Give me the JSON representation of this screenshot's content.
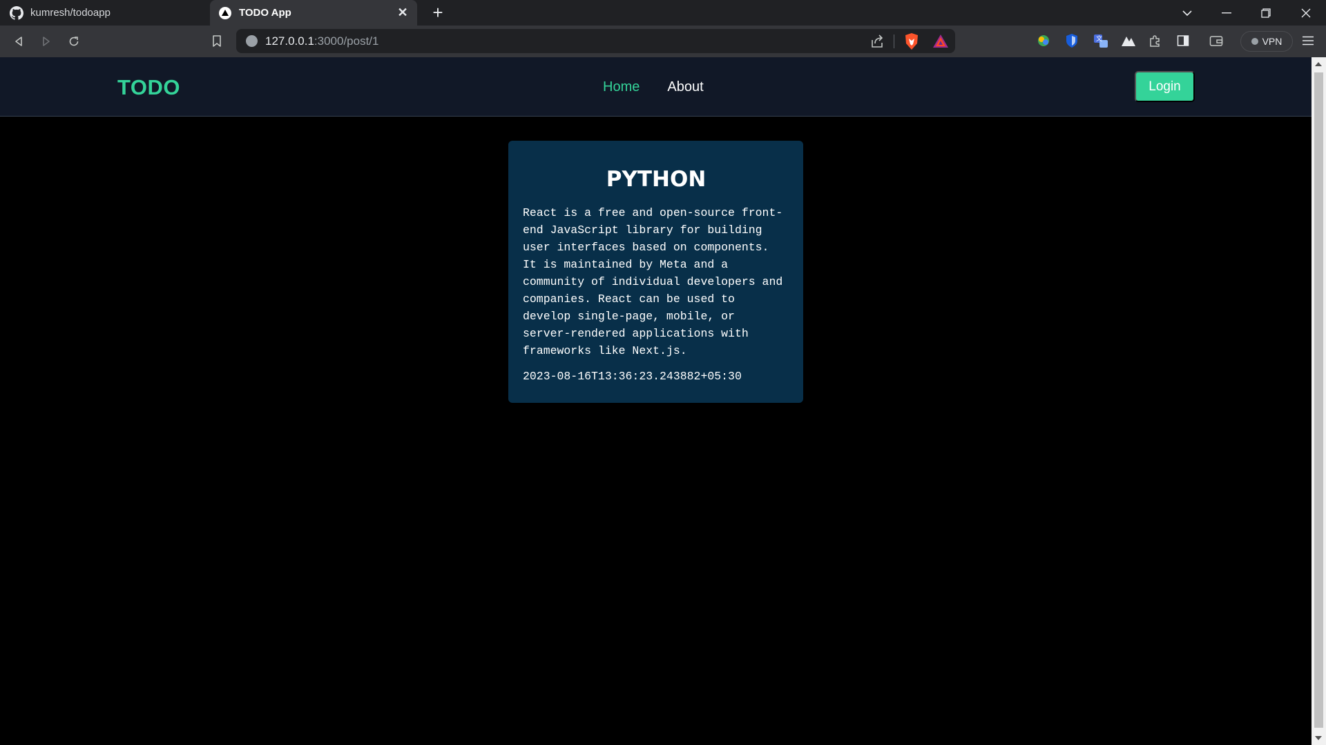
{
  "browser": {
    "tabs": [
      {
        "title": "kumresh/todoapp",
        "active": false,
        "icon": "github-icon"
      },
      {
        "title": "TODO App",
        "active": true,
        "icon": "vercel-triangle-icon"
      }
    ],
    "address": {
      "host": "127.0.0.1",
      "rest": ":3000/post/1"
    },
    "vpn_label": "VPN",
    "colors": {
      "tabbar": "#202124",
      "toolbar": "#35363a"
    }
  },
  "app": {
    "brand": "TODO",
    "nav": {
      "home": "Home",
      "about": "About"
    },
    "login_label": "Login",
    "colors": {
      "accent": "#34d399",
      "navbar": "#111827",
      "card": "#082f49",
      "background": "#000000"
    }
  },
  "post": {
    "title": "PYTHON",
    "body": "React is a free and open-source front-end JavaScript library for building user interfaces based on components. It is maintained by Meta and a community of individual developers and companies. React can be used to develop single-page, mobile, or server-rendered applications with frameworks like Next.js.",
    "timestamp": "2023-08-16T13:36:23.243882+05:30"
  }
}
